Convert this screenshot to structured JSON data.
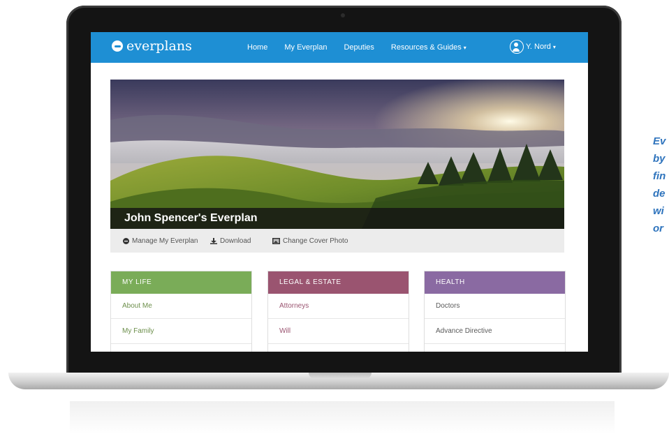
{
  "colors": {
    "nav_bg": "#1e8fd4",
    "my_life": "#7aac58",
    "legal_estate": "#9a5470",
    "health": "#8a6aa2",
    "side_text": "#2f74bd"
  },
  "navbar": {
    "logo": "everplans",
    "links": [
      "Home",
      "My Everplan",
      "Deputies",
      "Resources & Guides"
    ],
    "dropdown_caret": "▾",
    "user_label": "Y. Nord"
  },
  "cover": {
    "title": "John Spencer's Everplan"
  },
  "actions": {
    "manage": "Manage My Everplan",
    "download": "Download",
    "change_cover": "Change Cover Photo",
    "icons": [
      "manage-icon",
      "download-icon",
      "image-icon"
    ]
  },
  "cards": [
    {
      "title": "MY LIFE",
      "items": [
        "About Me",
        "My Family"
      ]
    },
    {
      "title": "LEGAL & ESTATE",
      "items": [
        "Attorneys",
        "Will"
      ]
    },
    {
      "title": "HEALTH",
      "items": [
        "Doctors",
        "Advance Directive"
      ]
    }
  ],
  "side_text": [
    "Ev",
    "by",
    "fin",
    "de",
    "wi",
    "or"
  ]
}
